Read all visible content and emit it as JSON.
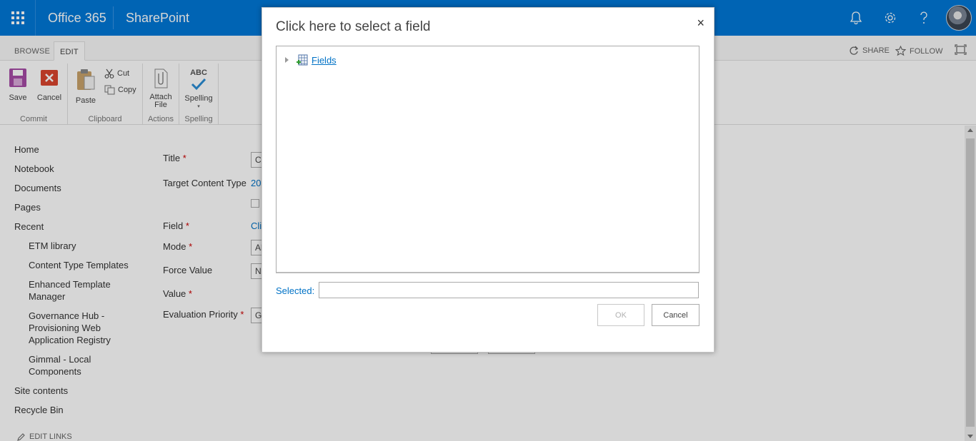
{
  "suite": {
    "brand": "Office 365",
    "app": "SharePoint"
  },
  "ribbon": {
    "tabs": [
      {
        "label": "BROWSE"
      },
      {
        "label": "EDIT"
      }
    ],
    "share_label": "SHARE",
    "follow_label": "FOLLOW",
    "groups": {
      "commit": {
        "label": "Commit",
        "save": "Save",
        "cancel": "Cancel"
      },
      "clipboard": {
        "label": "Clipboard",
        "paste": "Paste",
        "cut": "Cut",
        "copy": "Copy"
      },
      "actions": {
        "label": "Actions",
        "attach_line1": "Attach",
        "attach_line2": "File"
      },
      "spelling": {
        "label": "Spelling",
        "abc": "ABC",
        "spelling": "Spelling"
      }
    }
  },
  "leftnav": {
    "items": [
      "Home",
      "Notebook",
      "Documents",
      "Pages",
      "Recent"
    ],
    "recent": [
      "ETM library",
      "Content Type Templates",
      "Enhanced Template Manager",
      "Governance Hub - Provisioning Web Application Registry",
      "Gimmal - Local Components"
    ],
    "bottom": [
      "Site contents",
      "Recycle Bin"
    ],
    "edit_links": "EDIT LINKS"
  },
  "form": {
    "title_label": "Title",
    "title_value_fragment": "C",
    "target_label": "Target Content Type",
    "target_value_fragment": "20",
    "field_label": "Field",
    "field_value_fragment": "Cli",
    "mode_label": "Mode",
    "mode_value_fragment": "Al",
    "force_label": "Force Value",
    "force_value_fragment": "N",
    "value_label": "Value",
    "priority_label": "Evaluation Priority",
    "priority_value_fragment": "G",
    "required_marker": "*"
  },
  "dialog": {
    "title": "Click here to select a field",
    "close_glyph": "×",
    "tree_root": "Fields",
    "selected_label": "Selected:",
    "selected_value": "",
    "ok_label": "OK",
    "cancel_label": "Cancel"
  },
  "colors": {
    "suite_bar": "#0078d7",
    "link": "#0072c6",
    "save_icon": "#a64ca6",
    "cancel_icon": "#d9452e"
  }
}
